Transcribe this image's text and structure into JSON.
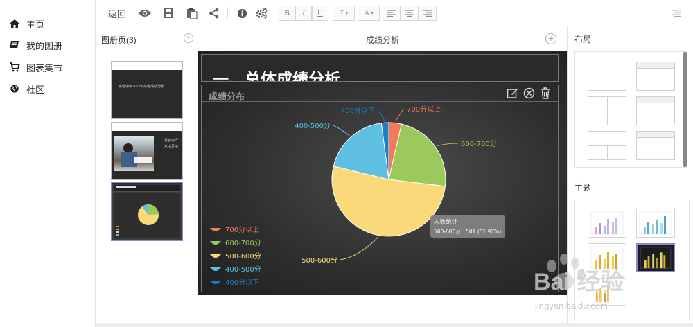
{
  "nav": {
    "items": [
      {
        "label": "主页",
        "icon": "home-icon"
      },
      {
        "label": "我的图册",
        "icon": "book-icon"
      },
      {
        "label": "图表集市",
        "icon": "cart-icon"
      },
      {
        "label": "社区",
        "icon": "globe-icon"
      }
    ]
  },
  "toolbar": {
    "back_label": "返回",
    "bold": "B",
    "italic": "I",
    "underline": "U",
    "text_type": "T",
    "font_color": "A"
  },
  "pages": {
    "title": "图册页(3)",
    "thumb1_title": "实验中学2015年高考成绩分析",
    "thumb2_text": "青春用汗水书写吧"
  },
  "canvas": {
    "title": "成绩分析",
    "slide_heading": "一、总体成绩分析",
    "panel_title": "成绩分布"
  },
  "chart_data": {
    "type": "pie",
    "title": "",
    "series_name": "人数统计",
    "slices": [
      {
        "label": "700分以上",
        "value": 35,
        "color": "#f47a5b"
      },
      {
        "label": "600-700分",
        "value": 225,
        "color": "#9cc95b"
      },
      {
        "label": "500-600分",
        "value": 501,
        "color": "#f9d97a"
      },
      {
        "label": "400-500分",
        "value": 185,
        "color": "#5fbfe0"
      },
      {
        "label": "400分以下",
        "value": 20,
        "color": "#1a7fc4"
      }
    ],
    "tooltip": {
      "title": "人数统计",
      "text": "500-600分 : 501 (51.97%)"
    },
    "legend_position": "bottom-left"
  },
  "right": {
    "layout_title": "布局",
    "theme_title": "主题"
  },
  "watermark": {
    "brand": "Bai 经验",
    "url": "jingyan.baidu.com"
  },
  "colors": {
    "selected_border": "#8f84d6",
    "slide_bg": "#2e2e2e"
  }
}
